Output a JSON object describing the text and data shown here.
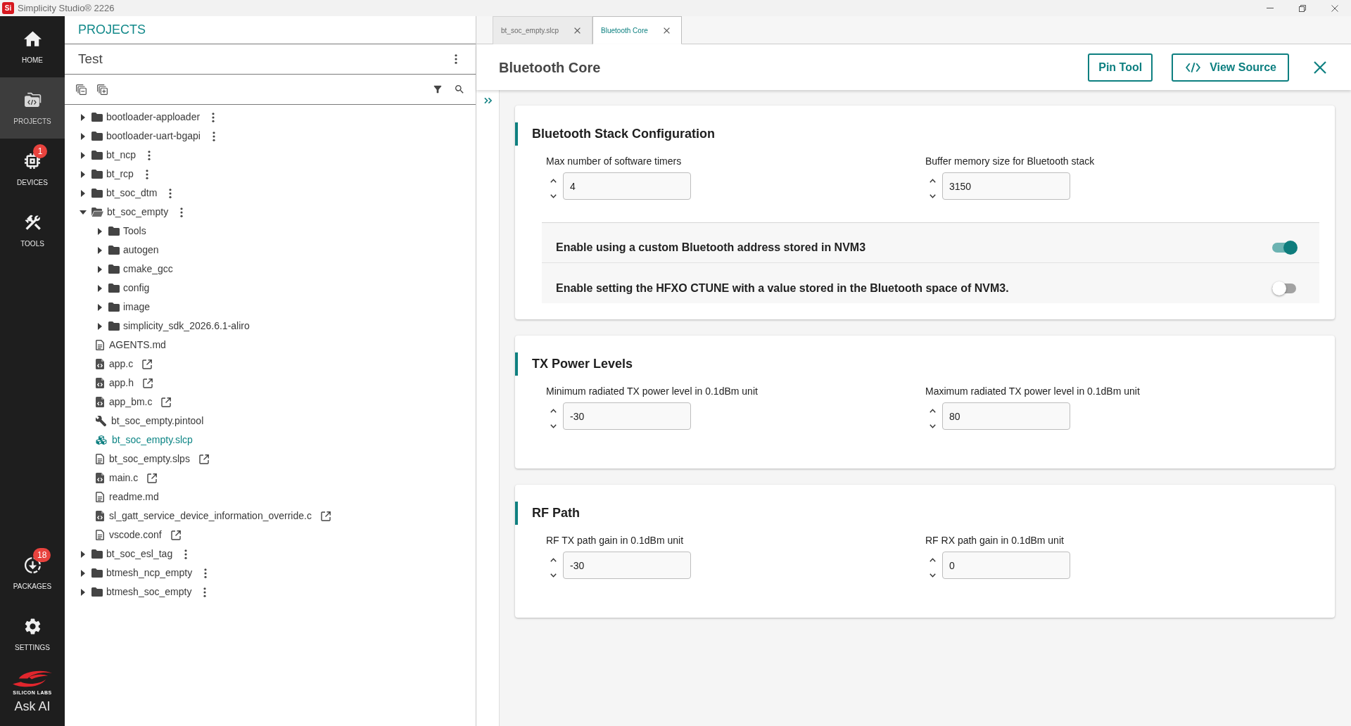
{
  "window": {
    "logo": "Si",
    "title": "Simplicity Studio® 2226"
  },
  "nav": {
    "top": [
      {
        "kind": "home",
        "label": "HOME",
        "selected": false
      },
      {
        "kind": "projects",
        "label": "PROJECTS",
        "selected": true
      },
      {
        "kind": "devices",
        "label": "DEVICES",
        "selected": false,
        "badge": "1"
      },
      {
        "kind": "tools",
        "label": "TOOLS",
        "selected": false
      }
    ],
    "bottom": [
      {
        "kind": "packages",
        "label": "PACKAGES",
        "selected": false,
        "badge": "18"
      },
      {
        "kind": "settings",
        "label": "SETTINGS",
        "selected": false
      }
    ],
    "brand": "SILICON LABS",
    "assistant": "Ask AI"
  },
  "projects": {
    "title": "PROJECTS",
    "workspace": "Test",
    "tree": [
      {
        "label": "bootloader-apploader",
        "kind": "project",
        "expanded": false
      },
      {
        "label": "bootloader-uart-bgapi",
        "kind": "project",
        "expanded": false
      },
      {
        "label": "bt_ncp",
        "kind": "project",
        "expanded": false
      },
      {
        "label": "bt_rcp",
        "kind": "project",
        "expanded": false
      },
      {
        "label": "bt_soc_dtm",
        "kind": "project",
        "expanded": false
      },
      {
        "label": "bt_soc_empty",
        "kind": "project",
        "expanded": true,
        "children": [
          {
            "label": "Tools",
            "kind": "folder",
            "expanded": false
          },
          {
            "label": "autogen",
            "kind": "folder",
            "expanded": false
          },
          {
            "label": "cmake_gcc",
            "kind": "folder",
            "expanded": false
          },
          {
            "label": "config",
            "kind": "folder",
            "expanded": false
          },
          {
            "label": "image",
            "kind": "folder",
            "expanded": false
          },
          {
            "label": "simplicity_sdk_2026.6.1-aliro",
            "kind": "folder",
            "expanded": false
          },
          {
            "label": "AGENTS.md",
            "kind": "text",
            "external": false
          },
          {
            "label": "app.c",
            "kind": "code",
            "external": true
          },
          {
            "label": "app.h",
            "kind": "code",
            "external": true
          },
          {
            "label": "app_bm.c",
            "kind": "code",
            "external": true
          },
          {
            "label": "bt_soc_empty.pintool",
            "kind": "tool",
            "external": false
          },
          {
            "label": "bt_soc_empty.slcp",
            "kind": "slcp",
            "external": false
          },
          {
            "label": "bt_soc_empty.slps",
            "kind": "text",
            "external": true
          },
          {
            "label": "main.c",
            "kind": "code",
            "external": true
          },
          {
            "label": "readme.md",
            "kind": "text",
            "external": false
          },
          {
            "label": "sl_gatt_service_device_information_override.c",
            "kind": "code",
            "external": true
          },
          {
            "label": "vscode.conf",
            "kind": "text",
            "external": true
          }
        ]
      },
      {
        "label": "bt_soc_esl_tag",
        "kind": "project",
        "expanded": false
      },
      {
        "label": "btmesh_ncp_empty",
        "kind": "project",
        "expanded": false
      },
      {
        "label": "btmesh_soc_empty",
        "kind": "project",
        "expanded": false
      }
    ]
  },
  "tabs": [
    {
      "label": "bt_soc_empty.slcp",
      "selected": false
    },
    {
      "label": "Bluetooth Core",
      "selected": true
    }
  ],
  "editor": {
    "title": "Bluetooth Core",
    "buttons": [
      {
        "kind": "pin",
        "label": "Pin Tool"
      },
      {
        "kind": "source",
        "label": "View Source"
      }
    ],
    "sections": [
      {
        "title": "Bluetooth Stack Configuration",
        "fields": [
          {
            "label": "Max number of software timers",
            "value": "4"
          },
          {
            "label": "Buffer memory size for Bluetooth stack",
            "value": "3150"
          }
        ],
        "toggles": [
          {
            "label": "Enable using a custom Bluetooth address stored in NVM3",
            "on": true
          },
          {
            "label": "Enable setting the HFXO CTUNE with a value stored in the Bluetooth space of NVM3.",
            "on": false
          }
        ]
      },
      {
        "title": "TX Power Levels",
        "fields": [
          {
            "label": "Minimum radiated TX power level in 0.1dBm unit",
            "value": "-30"
          },
          {
            "label": "Maximum radiated TX power level in 0.1dBm unit",
            "value": "80"
          }
        ]
      },
      {
        "title": "RF Path",
        "fields": [
          {
            "label": "RF TX path gain in 0.1dBm unit",
            "value": "-30"
          },
          {
            "label": "RF RX path gain in 0.1dBm unit",
            "value": "0"
          }
        ]
      }
    ]
  }
}
